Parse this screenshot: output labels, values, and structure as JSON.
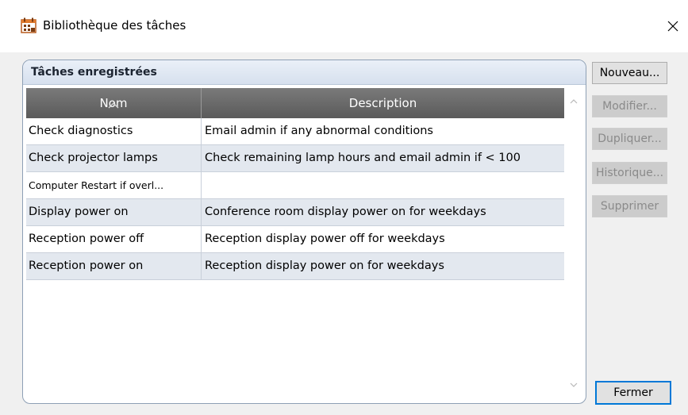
{
  "window": {
    "title": "Bibliothèque des tâches",
    "close_icon": "close-icon"
  },
  "group": {
    "title": "Tâches enregistrées"
  },
  "table": {
    "columns": [
      "Nom",
      "Description"
    ],
    "sorted_column": "Nom",
    "rows": [
      {
        "name": "Check diagnostics",
        "description": "Email admin if any abnormal conditions"
      },
      {
        "name": "Check projector lamps",
        "description": "Check remaining lamp hours and email admin if < 100"
      },
      {
        "name": "Computer Restart if overl...",
        "description": ""
      },
      {
        "name": "Display power on",
        "description": "Conference room display power on for weekdays"
      },
      {
        "name": "Reception power off",
        "description": "Reception display power off for weekdays"
      },
      {
        "name": "Reception power on",
        "description": "Reception display power on for weekdays"
      }
    ]
  },
  "buttons": {
    "new": "Nouveau...",
    "edit": "Modifier...",
    "duplicate": "Dupliquer...",
    "history": "Historique...",
    "delete": "Supprimer",
    "close": "Fermer"
  },
  "colors": {
    "header_bg": "#666666",
    "row_alt": "#e3e8ef",
    "default_button_border": "#0078d7"
  }
}
